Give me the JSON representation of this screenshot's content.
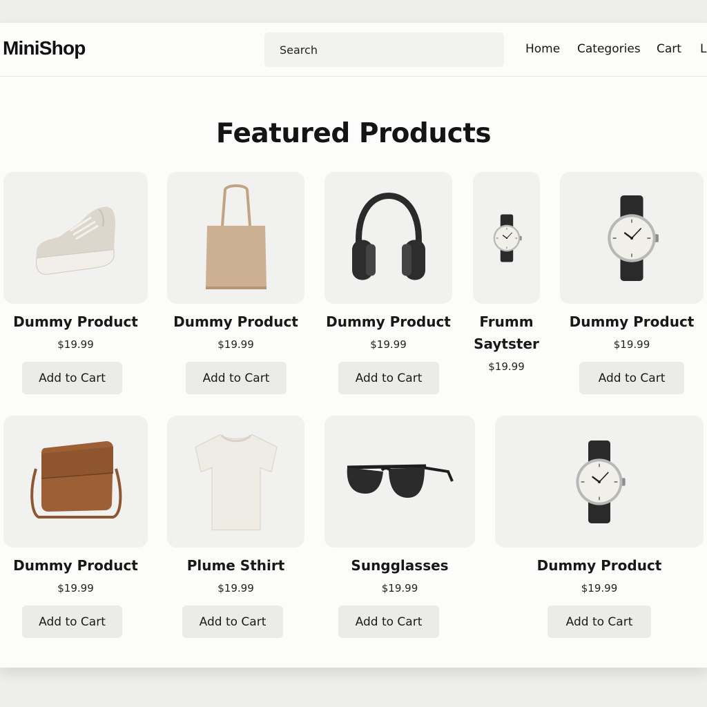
{
  "header": {
    "logo": "MiniShop",
    "search_placeholder": "Search",
    "search_value": "",
    "nav": [
      "Home",
      "Categories",
      "Cart",
      "L"
    ]
  },
  "main": {
    "heading": "Featured Products",
    "products": [
      {
        "name": "Dummy Product",
        "price": "$19.99",
        "button": "Add to Cart",
        "image": "sneaker-image"
      },
      {
        "name": "Dummy Product",
        "price": "$19.99",
        "button": "Add to Cart",
        "image": "tote-bag-image"
      },
      {
        "name": "Dummy Product",
        "price": "$19.99",
        "button": "Add to Cart",
        "image": "headphones-image"
      },
      {
        "name": "Frumm Saytster",
        "price": "$19.99",
        "button": "",
        "image": "wristwatch-image"
      },
      {
        "name": "Dummy Product",
        "price": "$19.99",
        "button": "Add to Cart",
        "image": "wristwatch-image"
      },
      {
        "name": "Dummy Product",
        "price": "$19.99",
        "button": "Add to Cart",
        "image": "shoulder-bag-image"
      },
      {
        "name": "Plume Sthirt",
        "price": "$19.99",
        "button": "Add to Cart",
        "image": "t-shirt-image"
      },
      {
        "name": "Sungglasses",
        "price": "$19.99",
        "button": "Add to Cart",
        "image": "sunglasses-image"
      },
      {
        "name": "Dummy Product",
        "price": "$19.99",
        "button": "Add to Cart",
        "image": "wristwatch-image"
      }
    ]
  },
  "colors": {
    "background": "#fcfcfa",
    "card_background": "#f1f1ef",
    "button_background": "#ebebe8",
    "text": "#1a1a1a"
  }
}
